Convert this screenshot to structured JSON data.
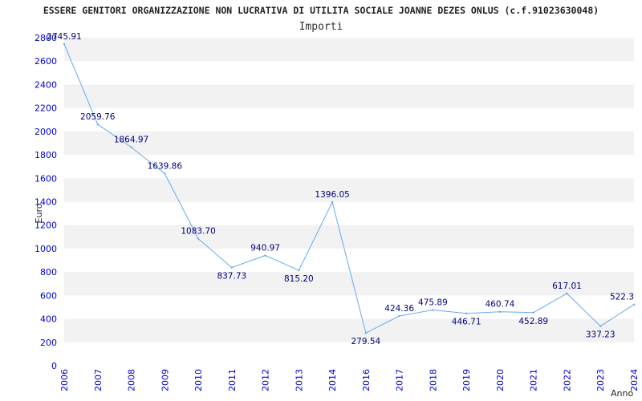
{
  "chart_data": {
    "type": "line",
    "title": "ESSERE GENITORI ORGANIZZAZIONE NON LUCRATIVA DI UTILITA SOCIALE JOANNE DEZES ONLUS (c.f.91023630048)",
    "subtitle": "Importi",
    "xlabel": "Anno",
    "ylabel": "Euro",
    "categories": [
      "2006",
      "2007",
      "2008",
      "2009",
      "2010",
      "2011",
      "2012",
      "2013",
      "2014",
      "2016",
      "2017",
      "2018",
      "2019",
      "2020",
      "2021",
      "2022",
      "2023",
      "2024"
    ],
    "value_labels": [
      "2745.91",
      "2059.76",
      "1864.97",
      "1639.86",
      "1083.70",
      "837.73",
      "940.97",
      "815.20",
      "1396.05",
      "279.54",
      "424.36",
      "475.89",
      "446.71",
      "460.74",
      "452.89",
      "617.01",
      "337.23",
      "522.3"
    ],
    "values": [
      2745.91,
      2059.76,
      1864.97,
      1639.86,
      1083.7,
      837.73,
      940.97,
      815.2,
      1396.05,
      279.54,
      424.36,
      475.89,
      446.71,
      460.74,
      452.89,
      617.01,
      337.23,
      522.3
    ],
    "ylim": [
      0,
      2800
    ],
    "yticks": [
      "0",
      "200",
      "400",
      "600",
      "800",
      "1000",
      "1200",
      "1400",
      "1600",
      "1800",
      "2000",
      "2200",
      "2400",
      "2600",
      "2800"
    ],
    "grid": true,
    "colors": {
      "line": "#66aaee",
      "band": "#f2f2f2",
      "tick_text": "#0000cc",
      "label_text": "#000080"
    }
  }
}
